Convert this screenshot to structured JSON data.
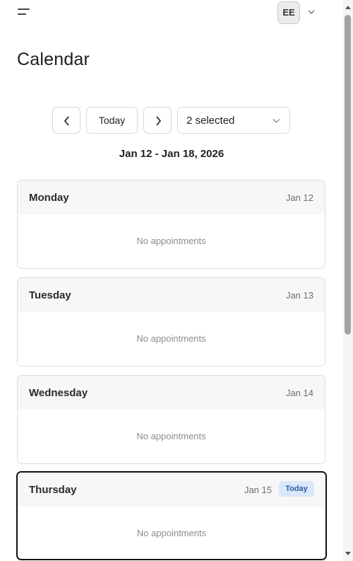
{
  "header": {
    "menu_icon": "hamburger-menu-icon",
    "avatar_initials": "EE",
    "avatar_menu_icon": "chevron-down-icon"
  },
  "page": {
    "title": "Calendar"
  },
  "toolbar": {
    "prev_icon": "chevron-left-icon",
    "today_label": "Today",
    "next_icon": "chevron-right-icon",
    "selection_label": "2 selected",
    "selection_icon": "chevron-down-icon"
  },
  "week": {
    "range_label": "Jan 12 - Jan 18, 2026",
    "days": [
      {
        "name": "Monday",
        "date": "Jan 12",
        "empty_text": "No appointments",
        "is_today": false
      },
      {
        "name": "Tuesday",
        "date": "Jan 13",
        "empty_text": "No appointments",
        "is_today": false
      },
      {
        "name": "Wednesday",
        "date": "Jan 14",
        "empty_text": "No appointments",
        "is_today": false
      },
      {
        "name": "Thursday",
        "date": "Jan 15",
        "empty_text": "No appointments",
        "is_today": true,
        "badge": "Today"
      }
    ]
  },
  "colors": {
    "today_badge_bg": "#d9e8fb",
    "today_badge_text": "#2e5da3",
    "today_border": "#111111"
  }
}
